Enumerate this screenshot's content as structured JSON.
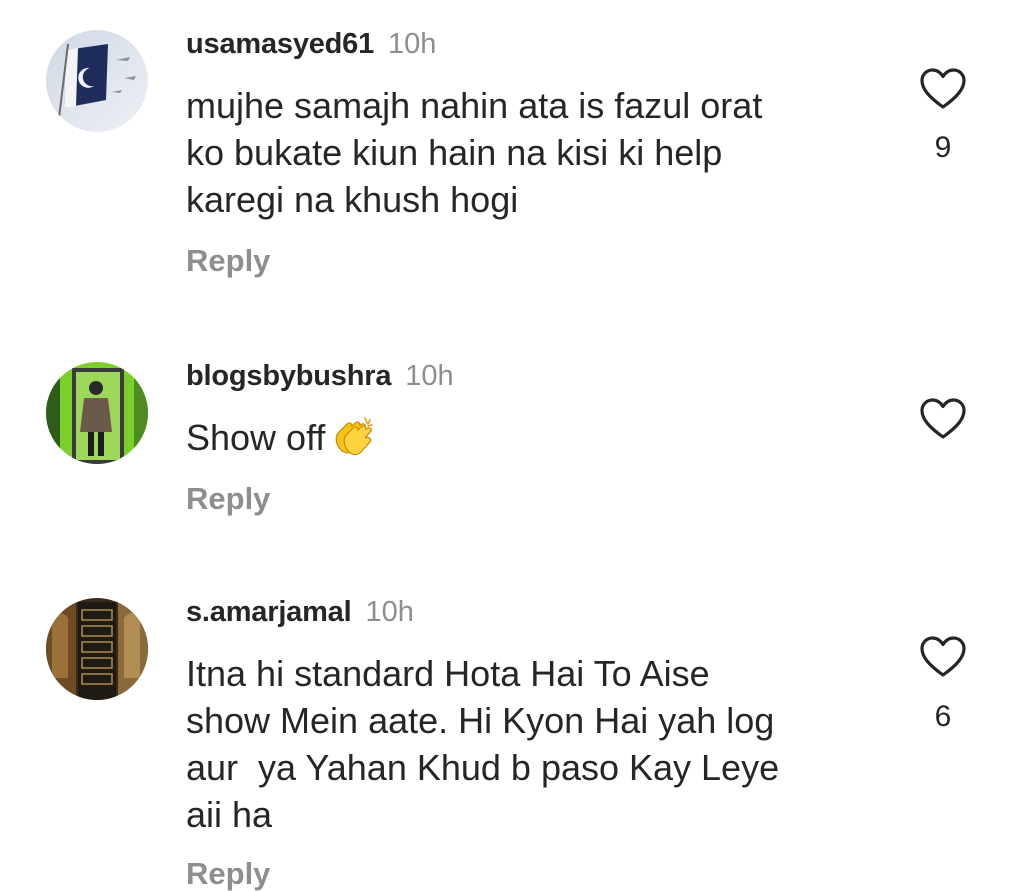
{
  "comments": [
    {
      "username": "usamasyed61",
      "time": "10h",
      "text_lines": [
        "mujhe samajh nahin ata is fazul orat",
        "ko bukate kiun hain na kisi ki help",
        "karegi na khush hogi"
      ],
      "reply_label": "Reply",
      "likes": "9",
      "avatar_icon": "flag-avatar-icon"
    },
    {
      "username": "blogsbybushra",
      "time": "10h",
      "text": "Show off",
      "emoji": "clapping-hands-emoji",
      "reply_label": "Reply",
      "avatar_icon": "person-photo-avatar-icon"
    },
    {
      "username": "s.amarjamal",
      "time": "10h",
      "text_lines": [
        "Itna hi standard Hota Hai To Aise",
        "show Mein aate. Hi Kyon Hai yah log",
        "aur  ya Yahan Khud b paso Kay Leye",
        "aii ha"
      ],
      "reply_label": "Reply",
      "likes": "6",
      "avatar_icon": "door-photo-avatar-icon"
    }
  ],
  "colors": {
    "text": "#262626",
    "secondary": "#8e8e8e",
    "background": "#ffffff"
  }
}
